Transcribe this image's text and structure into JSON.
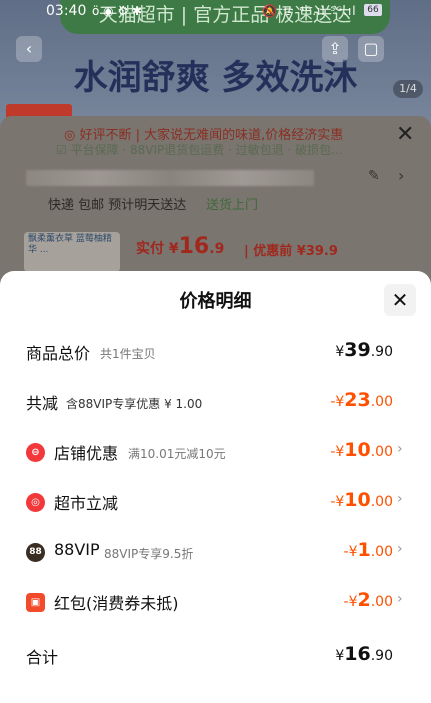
{
  "status_bar": {
    "time": "03:40",
    "icons": "ö ◉ ⚙ ✱",
    "right_icons": "🔕 ᯤ ⁴ᴳ.ıl ⁵ᴳ.ıl",
    "battery": "66"
  },
  "background": {
    "banner": "天猫超市 | 官方正品 极速送达",
    "hero_title": "水润舒爽 多效洗沐",
    "image_counter": "1/4",
    "notice_line1": "◎ 好评不断 | 大家说无难闻的味道,价格经济实惠",
    "notice_line2": "☑ 平台保障 · 88VIP退货包运费 · 过敏包退 · 破损包…",
    "shipping_left": "快递 包邮   预计明天送达",
    "shipping_right": "送货上门",
    "promo_thumb_text": "飘柔薰衣草 蓝莓柚精华 ...",
    "promo_price_prefix": "实付 ¥",
    "promo_price_int": "16",
    "promo_price_dec": ".9",
    "promo_before": "| 优惠前 ¥39.9"
  },
  "sheet": {
    "title": "价格明细",
    "rows": [
      {
        "label": "商品总价",
        "sub": "共1件宝贝",
        "currency": "¥",
        "amount": "39",
        "cents": ".90"
      },
      {
        "label": "共减",
        "sub": "含88VIP专享优惠 ¥ 1.00",
        "currency": "-¥",
        "amount": "23",
        "cents": ".00"
      },
      {
        "label": "店铺优惠",
        "sub": "满10.01元减10元",
        "currency": "-¥",
        "amount": "10",
        "cents": ".00"
      },
      {
        "label": "超市立减",
        "sub": "",
        "currency": "-¥",
        "amount": "10",
        "cents": ".00"
      },
      {
        "label": "88VIP",
        "sub": "88VIP专享9.5折",
        "currency": "-¥",
        "amount": "1",
        "cents": ".00"
      },
      {
        "label": "红包(消费券未抵)",
        "sub": "",
        "currency": "-¥",
        "amount": "2",
        "cents": ".00"
      },
      {
        "label": "合计",
        "sub": "",
        "currency": "¥",
        "amount": "16",
        "cents": ".90"
      }
    ],
    "icon_glyphs": {
      "shop": "⊖",
      "market": "◎",
      "vip": "88",
      "redpacket": "▣"
    }
  },
  "colors": {
    "accent_red": "#ff5000",
    "shop_icon": "#f2383b",
    "market_icon": "#f2383b",
    "vip_icon": "#3a2d22",
    "redpacket_icon": "#f24b2c"
  }
}
